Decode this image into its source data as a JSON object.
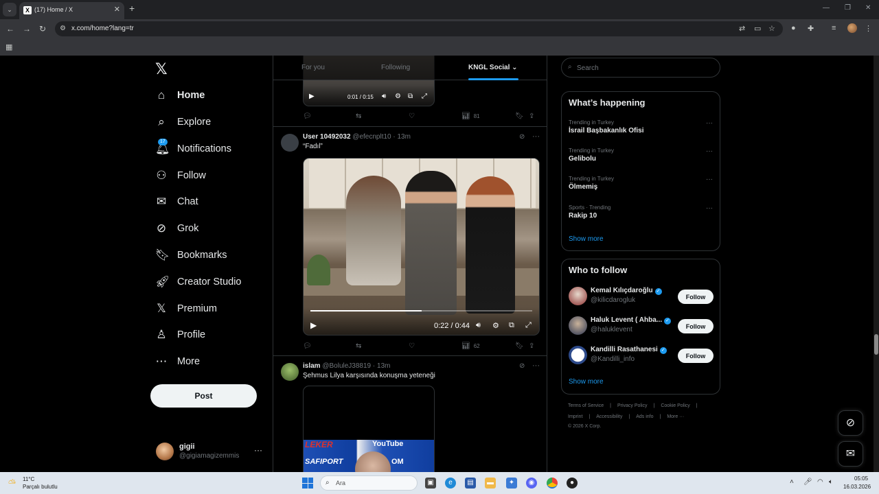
{
  "browser": {
    "tab_title": "(17) Home / X",
    "tab_favicon": "X",
    "url": "x.com/home?lang=tr"
  },
  "nav": {
    "logo": "𝕏",
    "items": [
      {
        "label": "Home",
        "icon": "home-icon"
      },
      {
        "label": "Explore",
        "icon": "search-icon"
      },
      {
        "label": "Notifications",
        "icon": "bell-icon",
        "badge": "17"
      },
      {
        "label": "Follow",
        "icon": "person-plus-icon"
      },
      {
        "label": "Chat",
        "icon": "envelope-icon"
      },
      {
        "label": "Grok",
        "icon": "grok-icon"
      },
      {
        "label": "Bookmarks",
        "icon": "bookmark-icon"
      },
      {
        "label": "Creator Studio",
        "icon": "rocket-icon"
      },
      {
        "label": "Premium",
        "icon": "x-premium-icon"
      },
      {
        "label": "Profile",
        "icon": "person-icon"
      },
      {
        "label": "More",
        "icon": "more-circle-icon"
      }
    ],
    "post_label": "Post",
    "account": {
      "name": "gigii",
      "handle": "@gigiamagizemmis"
    }
  },
  "timeline": {
    "tabs": [
      "For you",
      "Following",
      "KNGL Social"
    ],
    "post0": {
      "video_time": "0:01 / 0:15",
      "views": "81"
    },
    "post1": {
      "name": "User 10492032",
      "handle": "@efecnplt10",
      "time": "· 13m",
      "text": "“Fadıl”",
      "video_time": "0:22 / 0:44",
      "progress": 0.5,
      "views": "62"
    },
    "post2": {
      "name": "islam",
      "handle": "@BoluleJ38819",
      "time": "· 13m",
      "text": "Şehmus Lilya karşısında konuşma yeteneği",
      "banner_words": [
        "LEKER",
        "YouTube",
        "SAFIPORT",
        "OM"
      ]
    }
  },
  "sidebar": {
    "search_placeholder": "Search",
    "happening_title": "What’s happening",
    "trends": [
      {
        "meta": "Trending in Turkey",
        "topic": "İsrail Başbakanlık Ofisi"
      },
      {
        "meta": "Trending in Turkey",
        "topic": "Gelibolu"
      },
      {
        "meta": "Trending in Turkey",
        "topic": "Ölmemiş"
      },
      {
        "meta": "Sports · Trending",
        "topic": "Rakip 10"
      }
    ],
    "show_more": "Show more",
    "who_title": "Who to follow",
    "who": [
      {
        "name": "Kemal Kılıçdaroğlu",
        "handle": "@kilicdarogluk"
      },
      {
        "name": "Haluk Levent ( Ahba...",
        "handle": "@haluklevent"
      },
      {
        "name": "Kandilli Rasathanesi",
        "handle": "@Kandilli_info"
      }
    ],
    "follow_label": "Follow",
    "footer_line1": [
      "Terms of Service",
      "|",
      "Privacy Policy",
      "|",
      "Cookie Policy",
      "|"
    ],
    "footer_line2": [
      "Imprint",
      "|",
      "Accessibility",
      "|",
      "Ads info",
      "|",
      "More ···"
    ],
    "footer_line3": "© 2026 X Corp."
  },
  "taskbar": {
    "temp": "11°C",
    "weather": "Parçalı bulutlu",
    "search": "Ara",
    "time": "05:05",
    "date": "16.03.2026"
  }
}
